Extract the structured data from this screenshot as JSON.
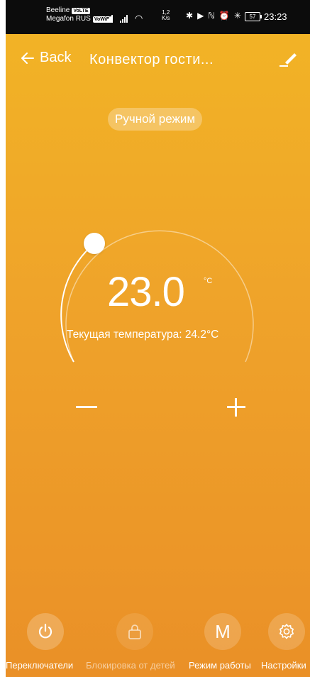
{
  "status_bar": {
    "carrier_1": "Beeline",
    "carrier_1_badge": "VoLTE",
    "carrier_2": "Megafon RUS",
    "carrier_2_badge": "VoWiFi",
    "speed_value": "1,2",
    "speed_unit": "K/s",
    "battery": "57",
    "time": "23:23"
  },
  "header": {
    "back_label": "Back",
    "title": "Конвектор гости..."
  },
  "mode_badge": "Ручной режим",
  "thermostat": {
    "set_temperature": "23.0",
    "unit": "°C",
    "current_label": "Текущая температура: 24.2°C",
    "current_temperature": 24.2
  },
  "bottom_bar": {
    "items": [
      {
        "label": "Переключатели",
        "icon": "power-icon",
        "enabled": true
      },
      {
        "label": "Блокировка от детей",
        "icon": "lock-icon",
        "enabled": false
      },
      {
        "label": "Режим работы",
        "icon": "mode-m-icon",
        "letter": "M",
        "enabled": true
      },
      {
        "label": "Настройки",
        "icon": "gear-icon",
        "enabled": true
      }
    ]
  },
  "colors": {
    "gradient_top": "#F2B525",
    "gradient_bottom": "#EA9027",
    "status_bar": "#0c0c0c",
    "text": "#ffffff"
  }
}
